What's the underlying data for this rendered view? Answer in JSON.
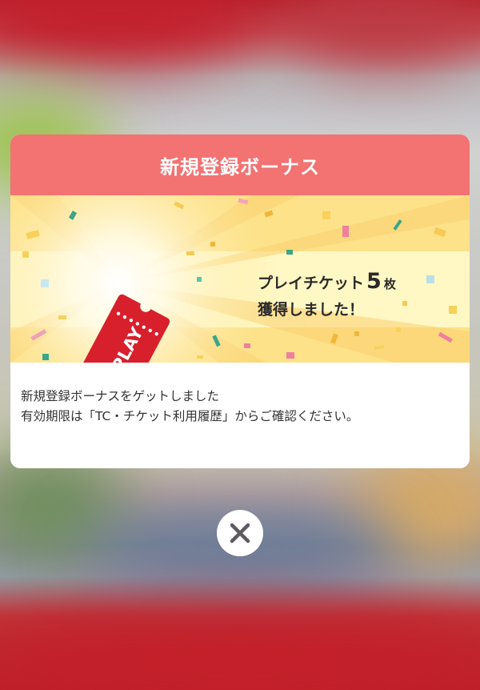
{
  "modal": {
    "title": "新規登録ボーナス",
    "reward_prefix": "プレイチケット",
    "reward_count": "5",
    "reward_unit": "枚",
    "reward_suffix": "獲得しました！",
    "ticket_label": "PLAY",
    "message_line1": "新規登録ボーナスをゲットしました",
    "message_line2": "有効期限は「TC・チケット利用履歴」からご確認ください。"
  },
  "close_button": {
    "icon": "close-icon"
  },
  "colors": {
    "header": "#f37272",
    "banner_yellow": "#fde48c",
    "ticket_red": "#d8202c"
  }
}
